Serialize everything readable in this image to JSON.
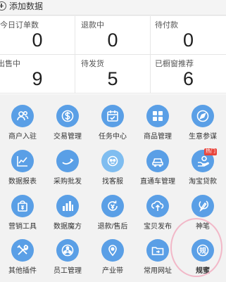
{
  "topbar": {
    "add_label": "添加数据"
  },
  "stats": [
    {
      "label": "今日订单数",
      "value": "0"
    },
    {
      "label": "退款中",
      "value": "0"
    },
    {
      "label": "待付款",
      "value": "0"
    },
    {
      "label": "出售中",
      "value": "9"
    },
    {
      "label": "待发货",
      "value": "5"
    },
    {
      "label": "已橱窗推荐",
      "value": "6"
    }
  ],
  "grid": {
    "icon_color": "#5a9fe6",
    "hot_badge": "热门",
    "items": [
      {
        "label": "商户入驻",
        "icon": "users-icon"
      },
      {
        "label": "交易管理",
        "icon": "dollar-icon"
      },
      {
        "label": "任务中心",
        "icon": "calendar-check-icon"
      },
      {
        "label": "商品管理",
        "icon": "grid-icon"
      },
      {
        "label": "生意参谋",
        "icon": "compass-icon"
      },
      {
        "label": "数据报表",
        "icon": "line-chart-icon"
      },
      {
        "label": "采购批发",
        "icon": "alibaba-icon"
      },
      {
        "label": "找客服",
        "icon": "chat-bot-icon"
      },
      {
        "label": "直通车管理",
        "icon": "car-icon"
      },
      {
        "label": "淘宝贷款",
        "icon": "loan-hand-icon"
      },
      {
        "label": "营销工具",
        "icon": "discount-bag-icon"
      },
      {
        "label": "数据魔方",
        "icon": "bar-chart-icon"
      },
      {
        "label": "退款/售后",
        "icon": "refund-icon"
      },
      {
        "label": "宝贝发布",
        "icon": "upload-icon"
      },
      {
        "label": "神笔",
        "icon": "pen-icon"
      },
      {
        "label": "其他插件",
        "icon": "tools-icon"
      },
      {
        "label": "员工管理",
        "icon": "share-people-icon"
      },
      {
        "label": "产业带",
        "icon": "location-pin-icon"
      },
      {
        "label": "常用网址",
        "icon": "folder-link-icon"
      },
      {
        "label": "规蜜",
        "icon": "rule-icon"
      }
    ]
  }
}
